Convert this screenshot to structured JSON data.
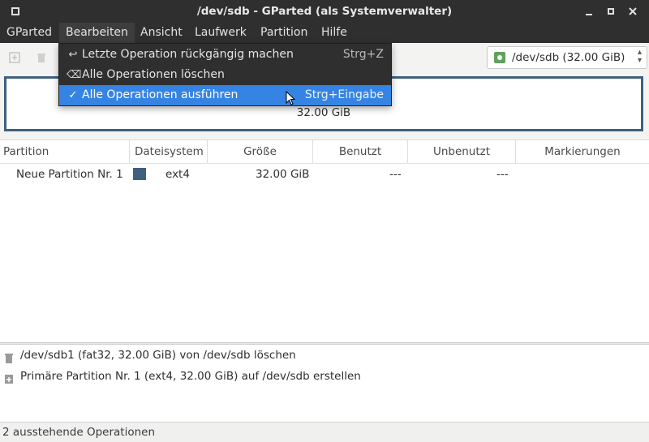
{
  "window": {
    "title": "/dev/sdb - GParted (als Systemverwalter)",
    "menu_icon": "window-menu-icon",
    "minimize_glyph": "‒",
    "maximize_glyph": "▫",
    "close_glyph": "✕"
  },
  "menubar": {
    "items": [
      "GParted",
      "Bearbeiten",
      "Ansicht",
      "Laufwerk",
      "Partition",
      "Hilfe"
    ]
  },
  "edit_menu": {
    "items": [
      {
        "icon": "↩",
        "label": "Letzte Operation rückgängig machen",
        "accel": "Strg+Z"
      },
      {
        "icon": "⌫",
        "label": "Alle Operationen löschen",
        "accel": ""
      },
      {
        "icon": "✓",
        "label": "Alle Operationen ausführen",
        "accel": "Strg+Eingabe"
      }
    ]
  },
  "device": {
    "label": "/dev/sdb  (32.00 GiB)"
  },
  "diskmap": {
    "size": "32.00 GiB"
  },
  "table": {
    "columns": [
      "Partition",
      "Dateisystem",
      "Größe",
      "Benutzt",
      "Unbenutzt",
      "Markierungen"
    ],
    "rows": [
      {
        "partition": "Neue Partition Nr. 1",
        "filesystem": "ext4",
        "size": "32.00 GiB",
        "used": "---",
        "unused": "---",
        "flags": "",
        "fs_color": "#3f5f7f"
      }
    ]
  },
  "operations": [
    {
      "icon": "trash-icon",
      "text": "/dev/sdb1 (fat32, 32.00 GiB) von /dev/sdb löschen"
    },
    {
      "icon": "new-partition-icon",
      "text": "Primäre Partition Nr. 1 (ext4, 32.00 GiB) auf /dev/sdb erstellen"
    }
  ],
  "status": {
    "text": "2 ausstehende Operationen"
  },
  "colors": {
    "highlight": "#3584e4",
    "dark_bg": "#2f2f2f",
    "ext4": "#3f5f7f"
  }
}
